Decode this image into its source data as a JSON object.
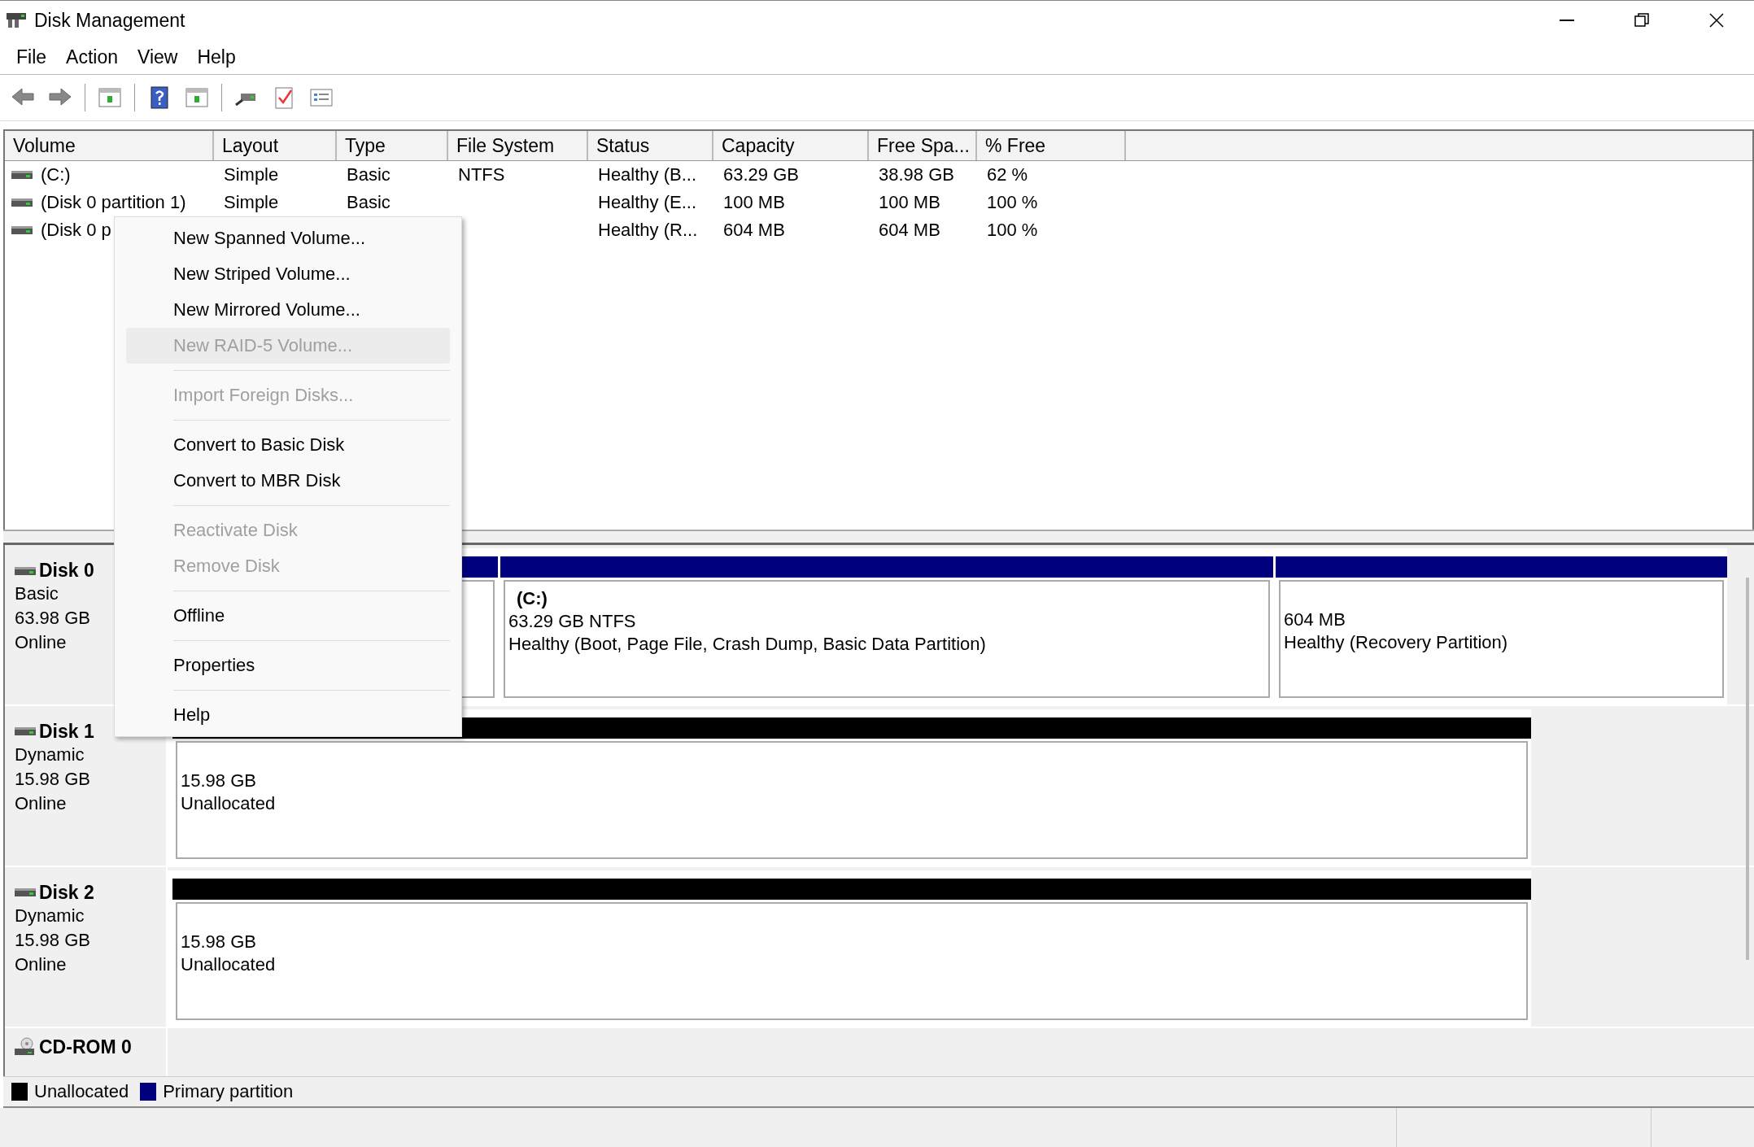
{
  "window": {
    "title": "Disk Management"
  },
  "menu_bar": [
    "File",
    "Action",
    "View",
    "Help"
  ],
  "volume_table": {
    "columns": [
      "Volume",
      "Layout",
      "Type",
      "File System",
      "Status",
      "Capacity",
      "Free Spa...",
      "% Free"
    ],
    "rows": [
      {
        "cells": [
          "(C:)",
          "Simple",
          "Basic",
          "NTFS",
          "Healthy (B...",
          "63.29 GB",
          "38.98 GB",
          "62 %"
        ]
      },
      {
        "cells": [
          "(Disk 0 partition 1)",
          "Simple",
          "Basic",
          "",
          "Healthy (E...",
          "100 MB",
          "100 MB",
          "100 %"
        ]
      },
      {
        "cells": [
          "(Disk 0 p",
          "",
          "",
          "",
          "Healthy (R...",
          "604 MB",
          "604 MB",
          "100 %"
        ]
      }
    ]
  },
  "disks": [
    {
      "name": "Disk 0",
      "kind": "disk",
      "type": "Basic",
      "size": "63.98 GB",
      "status": "Online",
      "partitions": [
        {
          "kind": "primary"
        },
        {
          "kind": "primary",
          "label": "(C:)",
          "size": "63.29 GB NTFS",
          "status": "Healthy (Boot, Page File, Crash Dump, Basic Data Partition)"
        },
        {
          "kind": "primary",
          "size": "604 MB",
          "status": "Healthy (Recovery Partition)"
        }
      ]
    },
    {
      "name": "Disk 1",
      "kind": "disk",
      "type": "Dynamic",
      "size": "15.98 GB",
      "status": "Online",
      "partitions": [
        {
          "kind": "unallocated",
          "size": "15.98 GB",
          "status": "Unallocated"
        }
      ]
    },
    {
      "name": "Disk 2",
      "kind": "disk",
      "type": "Dynamic",
      "size": "15.98 GB",
      "status": "Online",
      "partitions": [
        {
          "kind": "unallocated",
          "size": "15.98 GB",
          "status": "Unallocated"
        }
      ]
    },
    {
      "name": "CD-ROM 0",
      "kind": "cdrom"
    }
  ],
  "legend": [
    {
      "label": "Unallocated",
      "color": "#000000"
    },
    {
      "label": "Primary partition",
      "color": "#00007f"
    }
  ],
  "context_menu": [
    {
      "kind": "item",
      "label": "New Spanned Volume...",
      "disabled": false,
      "selected": false
    },
    {
      "kind": "item",
      "label": "New Striped Volume...",
      "disabled": false,
      "selected": false
    },
    {
      "kind": "item",
      "label": "New Mirrored Volume...",
      "disabled": false,
      "selected": false
    },
    {
      "kind": "item",
      "label": "New RAID-5 Volume...",
      "disabled": true,
      "selected": true
    },
    {
      "kind": "separator"
    },
    {
      "kind": "item",
      "label": "Import Foreign Disks...",
      "disabled": true,
      "selected": false
    },
    {
      "kind": "separator"
    },
    {
      "kind": "item",
      "label": "Convert to Basic Disk",
      "disabled": false,
      "selected": false
    },
    {
      "kind": "item",
      "label": "Convert to MBR Disk",
      "disabled": false,
      "selected": false
    },
    {
      "kind": "separator"
    },
    {
      "kind": "item",
      "label": "Reactivate Disk",
      "disabled": true,
      "selected": false
    },
    {
      "kind": "item",
      "label": "Remove Disk",
      "disabled": true,
      "selected": false
    },
    {
      "kind": "separator"
    },
    {
      "kind": "item",
      "label": "Offline",
      "disabled": false,
      "selected": false
    },
    {
      "kind": "separator"
    },
    {
      "kind": "item",
      "label": "Properties",
      "disabled": false,
      "selected": false
    },
    {
      "kind": "separator"
    },
    {
      "kind": "item",
      "label": "Help",
      "disabled": false,
      "selected": false
    }
  ]
}
